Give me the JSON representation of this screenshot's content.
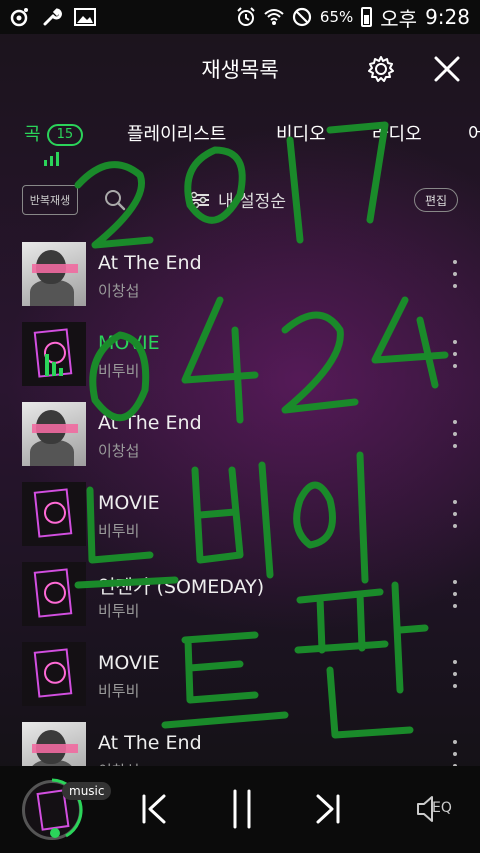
{
  "statusbar": {
    "battery": "65%",
    "ampm": "오후",
    "time": "9:28",
    "icons": [
      "camera-icon",
      "wrench-icon",
      "image-icon",
      "alarm-icon",
      "wifi-icon",
      "block-icon",
      "battery-icon"
    ]
  },
  "header": {
    "title": "재생목록",
    "icons": [
      "gear-icon",
      "close-icon"
    ]
  },
  "tabs": [
    {
      "label": "곡",
      "count": "15",
      "active": true
    },
    {
      "label": "플레이리스트"
    },
    {
      "label": "비디오"
    },
    {
      "label": "라디오"
    },
    {
      "label": "어"
    }
  ],
  "toolbar": {
    "repeat_label": "반복재생",
    "sort_label": "내 설정순",
    "edit_label": "편집"
  },
  "songs": [
    {
      "title": "At The End",
      "artist": "이창섭",
      "art": "face"
    },
    {
      "title": "MOVIE",
      "artist": "비투비",
      "art": "neon",
      "playing": true
    },
    {
      "title": "At The End",
      "artist": "이창섭",
      "art": "face"
    },
    {
      "title": "MOVIE",
      "artist": "비투비",
      "art": "neon"
    },
    {
      "title": "언젠가 (SOMEDAY)",
      "artist": "비투비",
      "art": "neon"
    },
    {
      "title": "MOVIE",
      "artist": "비투비",
      "art": "neon"
    },
    {
      "title": "At The End",
      "artist": "이창섭",
      "art": "face"
    }
  ],
  "player": {
    "badge": "music",
    "eq_label": "EQ"
  },
  "colors": {
    "accent": "#2bd45a",
    "scribble": "#1a8a2a",
    "neon": "#d24fe0"
  },
  "handwriting": {
    "line1": "2017",
    "line2": "0424",
    "line3": "느비이",
    "line4": "트판"
  }
}
